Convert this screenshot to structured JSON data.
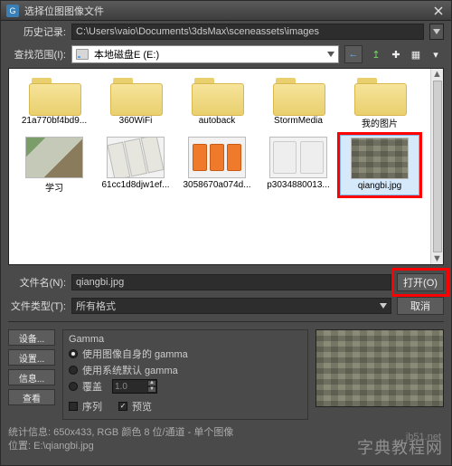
{
  "title": "选择位图图像文件",
  "history": {
    "label": "历史记录:",
    "path": "C:\\Users\\vaio\\Documents\\3dsMax\\sceneassets\\images"
  },
  "lookin": {
    "label": "查找范围(I):",
    "drive": "本地磁盘E (E:)"
  },
  "tool_icons": {
    "back": "←",
    "up": "↥",
    "newfolder": "✚",
    "viewmenu": "▦",
    "viewdd": "▾"
  },
  "folders": [
    {
      "name": "21a770bf4bd9..."
    },
    {
      "name": "360WiFi"
    },
    {
      "name": "autoback"
    },
    {
      "name": "StormMedia"
    },
    {
      "name": "我的图片"
    }
  ],
  "files": [
    {
      "name": "学习",
      "kind": "photo1"
    },
    {
      "name": "61cc1d8djw1ef...",
      "kind": "photo2"
    },
    {
      "name": "3058670a074d...",
      "kind": "orange"
    },
    {
      "name": "p3034880013...",
      "kind": "photo3"
    },
    {
      "name": "qiangbi.jpg",
      "kind": "wall",
      "selected": true,
      "highlighted": true
    }
  ],
  "filename": {
    "label": "文件名(N):",
    "value": "qiangbi.jpg"
  },
  "filetype": {
    "label": "文件类型(T):",
    "value": "所有格式"
  },
  "buttons": {
    "open": "打开(O)",
    "cancel": "取消"
  },
  "sidebtns": {
    "device": "设备...",
    "setup": "设置...",
    "info": "信息...",
    "view": "查看"
  },
  "gamma": {
    "legend": "Gamma",
    "opts": {
      "own": "使用图像自身的 gamma",
      "sys": "使用系统默认 gamma",
      "override": "覆盖"
    },
    "override_value": "1.0",
    "selected": "own"
  },
  "checks": {
    "sequence": "序列",
    "preview": "预览",
    "sequence_on": false,
    "preview_on": true
  },
  "status": {
    "line1": "统计信息: 650x433, RGB 颜色 8 位/通道 - 单个图像",
    "line2": "位置: E:\\qiangbi.jpg"
  },
  "watermark": {
    "main": "字典教程网",
    "sub": "jb51.net"
  }
}
